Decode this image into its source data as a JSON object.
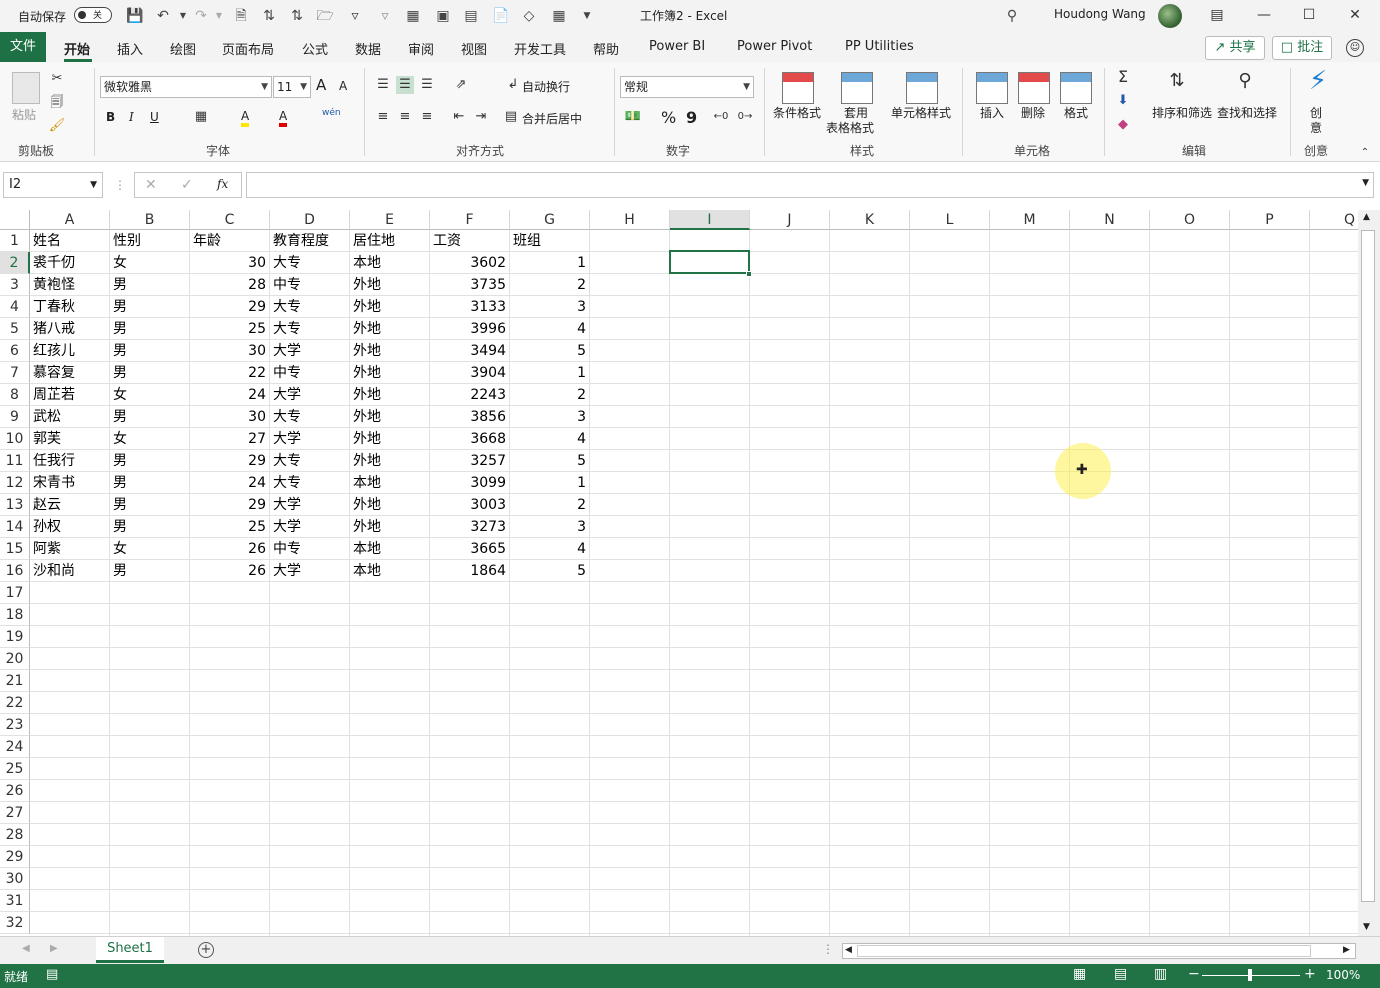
{
  "titlebar": {
    "autosave_label": "自动保存",
    "autosave_state": "关",
    "doc_title": "工作簿2  -  Excel",
    "user_name": "Houdong Wang"
  },
  "tabs": [
    "文件",
    "开始",
    "插入",
    "绘图",
    "页面布局",
    "公式",
    "数据",
    "审阅",
    "视图",
    "开发工具",
    "帮助",
    "Power BI",
    "Power Pivot",
    "PP Utilities"
  ],
  "tab_actions": {
    "share": "共享",
    "comments": "批注"
  },
  "ribbon": {
    "clipboard": {
      "paste": "粘贴",
      "group": "剪贴板"
    },
    "font": {
      "name": "微软雅黑",
      "size": "11",
      "group": "字体",
      "bold": "B",
      "italic": "I",
      "underline": "U",
      "grow": "A",
      "shrink": "A",
      "fill": "A",
      "color": "A",
      "pinyin": "wén"
    },
    "alignment": {
      "wrap": "自动换行",
      "merge": "合并后居中",
      "group": "对齐方式"
    },
    "number": {
      "format": "常规",
      "percent": "%",
      "comma": "9",
      "group": "数字"
    },
    "styles": {
      "conditional": "条件格式",
      "table1": "套用",
      "table2": "表格格式",
      "cell_styles": "单元格样式",
      "group": "样式"
    },
    "cells": {
      "insert": "插入",
      "delete": "删除",
      "format": "格式",
      "group": "单元格"
    },
    "editing": {
      "sort": "排序和筛选",
      "find": "查找和选择",
      "group": "编辑"
    },
    "ideas": {
      "label1": "创",
      "label2": "意",
      "group": "创意"
    }
  },
  "formula_bar": {
    "name_box": "I2",
    "fx": "fx",
    "content": ""
  },
  "columns": [
    "A",
    "B",
    "C",
    "D",
    "E",
    "F",
    "G",
    "H",
    "I",
    "J",
    "K",
    "L",
    "M",
    "N",
    "O",
    "P",
    "Q"
  ],
  "rows": [
    "1",
    "2",
    "3",
    "4",
    "5",
    "6",
    "7",
    "8",
    "9",
    "10",
    "11",
    "12",
    "13",
    "14",
    "15",
    "16",
    "17",
    "18",
    "19",
    "20",
    "21",
    "22",
    "23",
    "24",
    "25",
    "26",
    "27",
    "28",
    "29",
    "30",
    "31",
    "32"
  ],
  "table": {
    "headers": [
      "姓名",
      "性别",
      "年龄",
      "教育程度",
      "居住地",
      "工资",
      "班组"
    ],
    "rows": [
      [
        "裘千仞",
        "女",
        "30",
        "大专",
        "本地",
        "3602",
        "1"
      ],
      [
        "黄袍怪",
        "男",
        "28",
        "中专",
        "外地",
        "3735",
        "2"
      ],
      [
        "丁春秋",
        "男",
        "29",
        "大专",
        "外地",
        "3133",
        "3"
      ],
      [
        "猪八戒",
        "男",
        "25",
        "大专",
        "外地",
        "3996",
        "4"
      ],
      [
        "红孩儿",
        "男",
        "30",
        "大学",
        "外地",
        "3494",
        "5"
      ],
      [
        "慕容复",
        "男",
        "22",
        "中专",
        "外地",
        "3904",
        "1"
      ],
      [
        "周芷若",
        "女",
        "24",
        "大学",
        "外地",
        "2243",
        "2"
      ],
      [
        "武松",
        "男",
        "30",
        "大专",
        "外地",
        "3856",
        "3"
      ],
      [
        "郭芙",
        "女",
        "27",
        "大学",
        "外地",
        "3668",
        "4"
      ],
      [
        "任我行",
        "男",
        "29",
        "大专",
        "外地",
        "3257",
        "5"
      ],
      [
        "宋青书",
        "男",
        "24",
        "大专",
        "本地",
        "3099",
        "1"
      ],
      [
        "赵云",
        "男",
        "29",
        "大学",
        "外地",
        "3003",
        "2"
      ],
      [
        "孙权",
        "男",
        "25",
        "大学",
        "外地",
        "3273",
        "3"
      ],
      [
        "阿紫",
        "女",
        "26",
        "中专",
        "本地",
        "3665",
        "4"
      ],
      [
        "沙和尚",
        "男",
        "26",
        "大学",
        "本地",
        "1864",
        "5"
      ]
    ]
  },
  "sheets": {
    "active": "Sheet1",
    "add": "+"
  },
  "status": {
    "ready": "就绪",
    "zoom": "100%"
  },
  "colors": {
    "accent": "#217346",
    "file_tab": "#1e7145"
  }
}
